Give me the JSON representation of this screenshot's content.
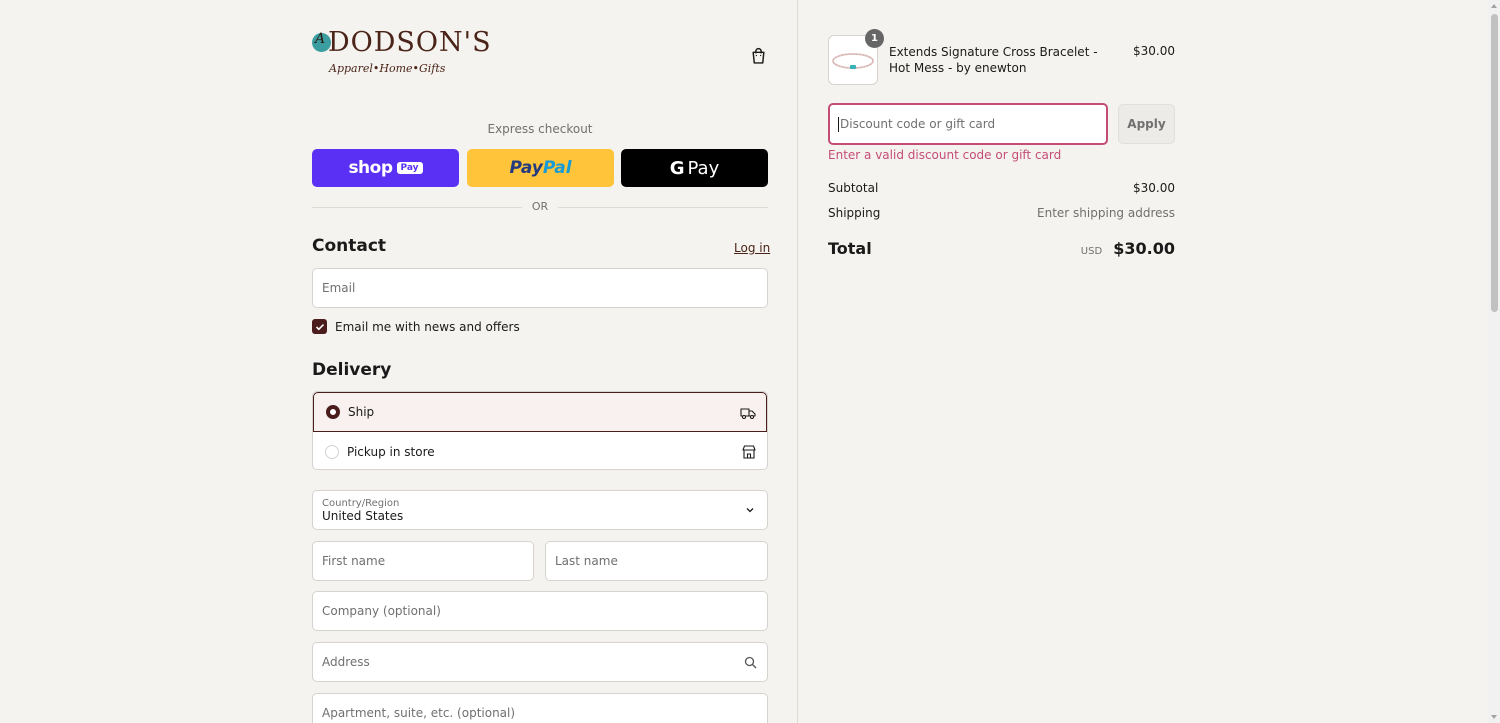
{
  "brand": {
    "circle_letter": "A",
    "name": "DODSON'S",
    "tagline": "Apparel•Home•Gifts"
  },
  "express": {
    "title": "Express checkout",
    "shoppay_text": "shop",
    "shoppay_badge": "Pay",
    "paypal_part1": "Pay",
    "paypal_part2": "Pal",
    "gpay_g": "G",
    "gpay_text": "Pay",
    "or": "OR"
  },
  "contact": {
    "title": "Contact",
    "login_label": "Log in",
    "email_placeholder": "Email",
    "newsletter_label": "Email me with news and offers",
    "newsletter_checked": true
  },
  "delivery": {
    "title": "Delivery",
    "options": [
      {
        "label": "Ship",
        "selected": true,
        "icon": "truck-icon"
      },
      {
        "label": "Pickup in store",
        "selected": false,
        "icon": "store-icon"
      }
    ],
    "country_label": "Country/Region",
    "country_value": "United States",
    "first_name_placeholder": "First name",
    "last_name_placeholder": "Last name",
    "company_placeholder": "Company (optional)",
    "address_placeholder": "Address",
    "apartment_placeholder": "Apartment, suite, etc. (optional)"
  },
  "order": {
    "items": [
      {
        "quantity": "1",
        "name": "Extends Signature Cross Bracelet - Hot Mess - by enewton",
        "price": "$30.00"
      }
    ],
    "discount_placeholder": "Discount code or gift card",
    "apply_label": "Apply",
    "discount_error": "Enter a valid discount code or gift card",
    "subtotal_label": "Subtotal",
    "subtotal_value": "$30.00",
    "shipping_label": "Shipping",
    "shipping_value": "Enter shipping address",
    "total_label": "Total",
    "total_currency": "USD",
    "total_value": "$30.00"
  },
  "colors": {
    "accent": "#4a1c1c",
    "error": "#c44d78",
    "shoppay": "#5a31f4",
    "paypal": "#ffc439",
    "gpay": "#000000"
  }
}
